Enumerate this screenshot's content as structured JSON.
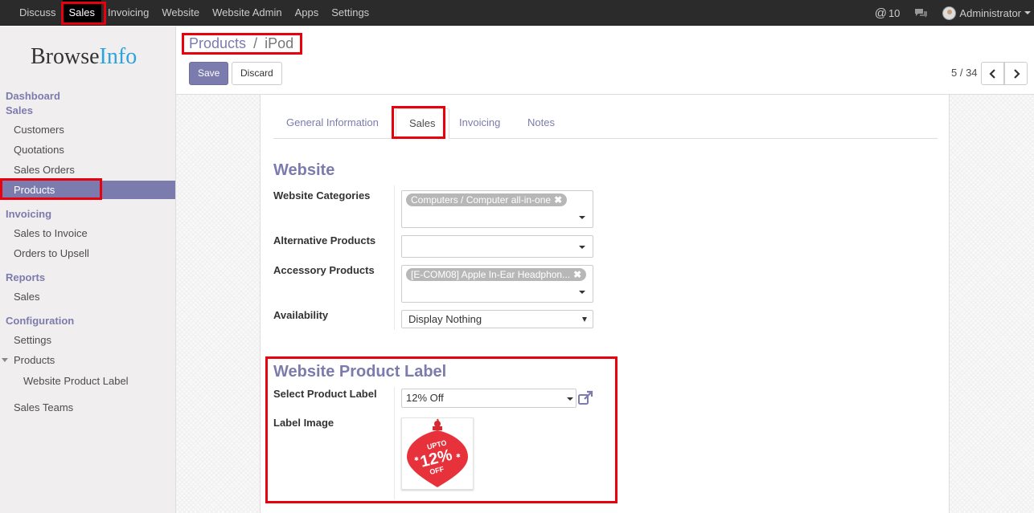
{
  "topbar": {
    "menu": [
      "Discuss",
      "Sales",
      "Invoicing",
      "Website",
      "Website Admin",
      "Apps",
      "Settings"
    ],
    "active_menu": "Sales",
    "mentions_count": "10",
    "user": "Administrator"
  },
  "sidebar": {
    "logo": {
      "part1": "Browse",
      "part2": "Info"
    },
    "sections": {
      "dashboard": "Dashboard",
      "sales": "Sales",
      "invoicing": "Invoicing",
      "reports": "Reports",
      "configuration": "Configuration"
    },
    "items": {
      "customers": "Customers",
      "quotations": "Quotations",
      "sales_orders": "Sales Orders",
      "products": "Products",
      "sales_to_invoice": "Sales to Invoice",
      "orders_to_upsell": "Orders to Upsell",
      "report_sales": "Sales",
      "settings": "Settings",
      "config_products": "Products",
      "website_product_label": "Website Product Label",
      "sales_teams": "Sales Teams"
    }
  },
  "breadcrumb": {
    "parent": "Products",
    "separator": "/",
    "current": "iPod"
  },
  "buttons": {
    "save": "Save",
    "discard": "Discard"
  },
  "pager": {
    "text": "5 / 34"
  },
  "tabs": [
    "General Information",
    "Sales",
    "Invoicing",
    "Notes"
  ],
  "active_tab": "Sales",
  "website_section": {
    "title": "Website",
    "website_categories": {
      "label": "Website Categories",
      "tag": "Computers / Computer all-in-one"
    },
    "alternative_products": {
      "label": "Alternative Products"
    },
    "accessory_products": {
      "label": "Accessory Products",
      "tag": "[E-COM08] Apple In-Ear Headphon..."
    },
    "availability": {
      "label": "Availability",
      "value": "Display Nothing"
    }
  },
  "label_section": {
    "title": "Website Product Label",
    "select_label": {
      "label": "Select Product Label",
      "value": "12% Off"
    },
    "label_image": {
      "label": "Label Image",
      "text_upto": "UPTO",
      "text_percent": "12%",
      "text_off": "OFF"
    }
  },
  "colors": {
    "accent": "#7c7bad",
    "highlight": "#e8000d",
    "badge": "#e8323b"
  }
}
